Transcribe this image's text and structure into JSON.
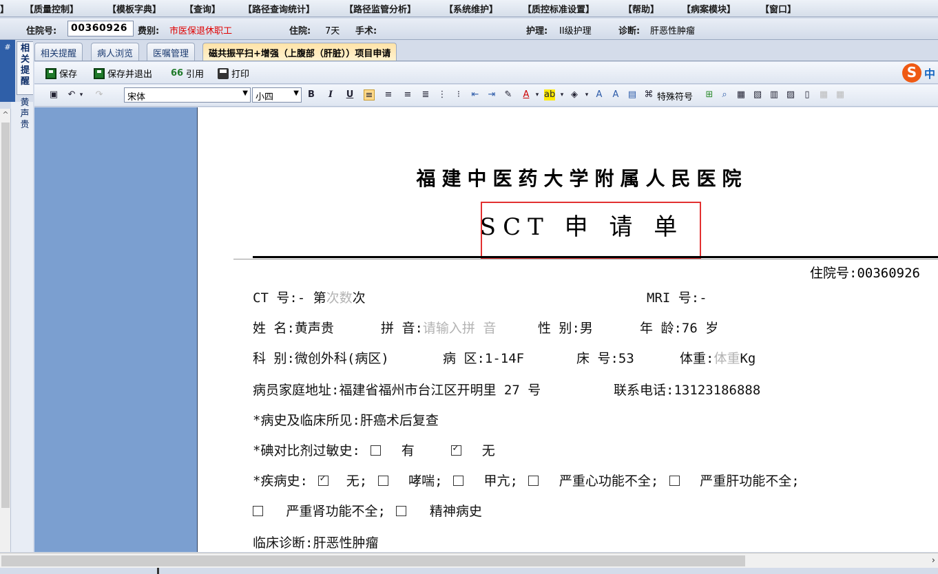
{
  "menu": [
    "】",
    "【质量控制】",
    "【模板字典】",
    "【查询】",
    "【路径查询统计】",
    "【路径监管分析】",
    "【系统维护】",
    "【质控标准设置】",
    "【帮助】",
    "【病案模块】",
    "【窗口】"
  ],
  "info": {
    "adm_label": "住院号:",
    "adm_value": "00360926",
    "fee_label": "费别:",
    "fee_value": "市医保退休职工",
    "stay_label": "住院:",
    "stay_value": "7天",
    "surgery_label": "手术:",
    "nursing_label": "护理:",
    "nursing_value": "II级护理",
    "diag_label": "诊断:",
    "diag_value": "肝恶性肿瘤"
  },
  "side": {
    "pin": "#",
    "vtab1": "相关提醒",
    "vtab2": "黄声贵"
  },
  "tabs": [
    "相关提醒",
    "病人浏览",
    "医嘱管理",
    "磁共振平扫+增强（上腹部（肝脏））项目申请"
  ],
  "toolbar1": {
    "save": "保存",
    "save_exit": "保存并退出",
    "quote": "引用",
    "print": "打印",
    "ime_logo": "S",
    "ime_lang": "中"
  },
  "toolbar2": {
    "font": "宋体",
    "size": "小四",
    "special_chars": "特殊符号"
  },
  "document": {
    "hospital": "福建中医药大学附属人民医院",
    "form_title": "SCT 申 请 单",
    "adm_no": "住院号:00360926",
    "ct_label": "CT 号:- 第",
    "ct_ph": "次数",
    "ct_suffix": "次",
    "mri": "MRI 号:-",
    "name": "姓 名:黄声贵",
    "pinyin_label": "拼 音:",
    "pinyin_ph": "请输入拼 音",
    "sex": "性 别:男",
    "age": "年 龄:76 岁",
    "dept": "科 别:微创外科(病区)",
    "ward": "病 区:1-14F",
    "bed": "床 号:53",
    "weight_label": "体重:",
    "weight_ph": "体重",
    "weight_unit": "Kg",
    "address": "病员家庭地址:福建省福州市台江区开明里 27 号",
    "phone": "联系电话:13123186888",
    "history": "*病史及临床所见:肝癌术后复查",
    "allergy_label": "*碘对比剂过敏史:",
    "allergy_yes": "有",
    "allergy_no": "无",
    "disease_label": "*疾病史:",
    "d_none": "无;",
    "d_asthma": "哮喘;",
    "d_hyper": "甲亢;",
    "d_heart": "严重心功能不全;",
    "d_liver": "严重肝功能不全;",
    "d_kidney": "严重肾功能不全;",
    "d_mental": "精神病史",
    "clinical_diag": "临床诊断:肝恶性肿瘤"
  }
}
